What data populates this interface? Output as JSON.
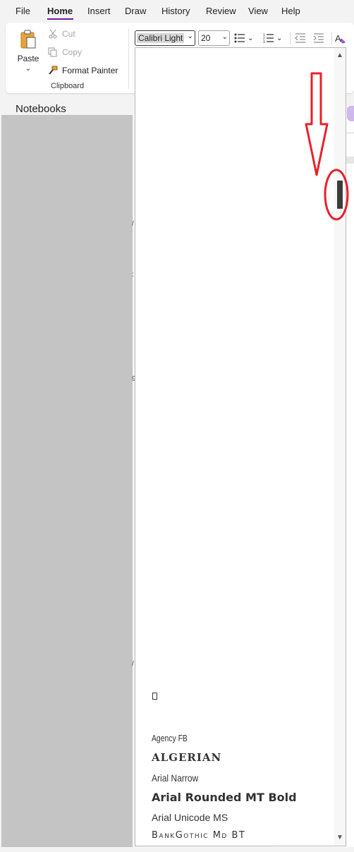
{
  "menu": {
    "items": [
      "File",
      "Home",
      "Insert",
      "Draw",
      "History",
      "Review",
      "View",
      "Help"
    ],
    "active": "Home"
  },
  "ribbon": {
    "paste_label": "Paste",
    "cut_label": "Cut",
    "copy_label": "Copy",
    "format_painter_label": "Format Painter",
    "clipboard_group_label": "Clipboard",
    "font_name": "Calibri Light",
    "font_size": "20"
  },
  "nav": {
    "notebooks_label": "Notebooks"
  },
  "font_dropdown": {
    "fonts": [
      "Agency FB",
      "ALGERIAN",
      "Arial Narrow",
      "Arial Rounded MT Bold",
      "Arial Unicode MS",
      "BankGothic Md BT"
    ],
    "scroll_up_glyph": "▲",
    "scroll_down_glyph": "▼"
  },
  "colors": {
    "accent": "#7719aa",
    "annotation": "#e8202a",
    "nav_pane": "#c4c4c4",
    "scroll_thumb": "#3b3b3b"
  }
}
